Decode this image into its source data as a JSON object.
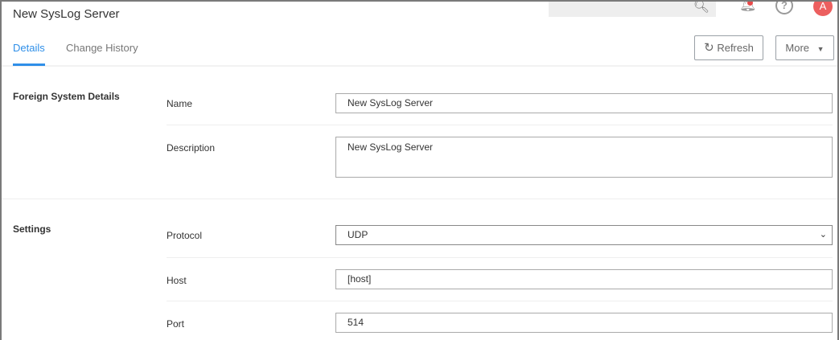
{
  "header": {
    "title": "New SysLog Server",
    "notification_color": "#e84a4a",
    "avatar_letter": "A",
    "avatar_color": "#ec5f5f"
  },
  "tabs": [
    {
      "label": "Details",
      "active": true
    },
    {
      "label": "Change History",
      "active": false
    }
  ],
  "toolbar": {
    "refresh_label": "Refresh",
    "more_label": "More"
  },
  "sections": {
    "foreign": {
      "title": "Foreign System Details",
      "name_label": "Name",
      "name_value": "New SysLog Server",
      "description_label": "Description",
      "description_value": "New SysLog Server"
    },
    "settings": {
      "title": "Settings",
      "protocol_label": "Protocol",
      "protocol_value": "UDP",
      "host_label": "Host",
      "host_value": "[host]",
      "port_label": "Port",
      "port_value": "514"
    }
  },
  "accent": "#2f8fe8"
}
